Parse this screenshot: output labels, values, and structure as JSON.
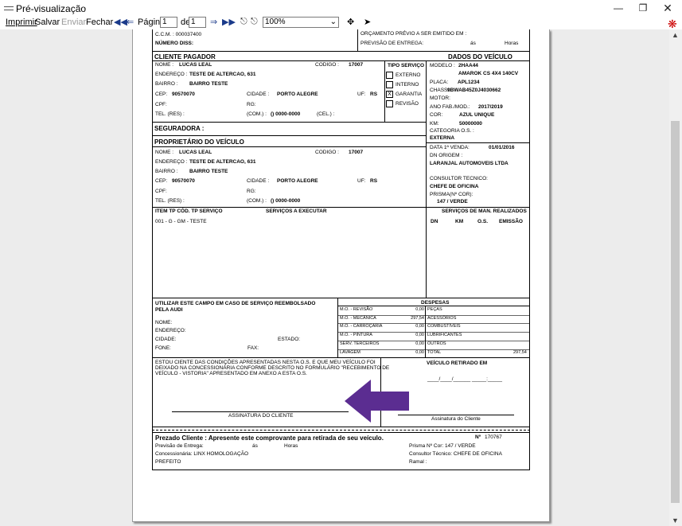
{
  "window": {
    "title": "Pré-visualização",
    "app_icon": "keyboard-icon"
  },
  "menu": {
    "imprimir": "Imprimir",
    "salvar": "Salvar",
    "enviar": "Enviar",
    "fechar": "Fechar",
    "pagina_label": "Página",
    "pagina_value": "1",
    "de_label": "de",
    "de_value": "1",
    "zoom": "100%"
  },
  "doc": {
    "ccm": "C.C.M. : 000037400",
    "numero_diss": "NÚMERO DISS:",
    "orcamento": "ORÇAMENTO PRÉVIO A SER EMITIDO EM :",
    "previsao": "PREVISÃO DE ENTREGA:",
    "as": "ás",
    "horas": "Horas",
    "cliente_pagador": "CLIENTE PAGADOR",
    "dados_veiculo": "DADOS DO VEÍCULO",
    "nome_label": "NOME :",
    "nome": "LUCAS LEAL",
    "codigo_label": "CODIGO :",
    "codigo": "17007",
    "endereco_label": "ENDEREÇO :",
    "endereco": "TESTE DE ALTERCAO, 631",
    "bairro_label": "BAIRRO :",
    "bairro": "BAIRRO TESTE",
    "cep_label": "CEP:",
    "cep": "90570070",
    "cidade_label": "CIDADE :",
    "cidade": "PORTO ALEGRE",
    "uf_label": "UF:",
    "uf": "RS",
    "cpf_label": "CPF:",
    "rg_label": "RG:",
    "tel_label": "TEL. (RES) :",
    "com_label": "(COM.) :",
    "com": "() 0000-0000",
    "cel_label": "(CEL.) :",
    "tipo_servico": "TIPO SERVIÇO",
    "tipo_opts": [
      "EXTERNO",
      "INTERNO",
      "GARANTIA",
      "REVISÃO"
    ],
    "tipo_checked": "X",
    "modelo_label": "MODELO :",
    "modelo": "2HAA44",
    "modelo2": "AMAROK CS 4X4 140CV",
    "placa_label": "PLACA:",
    "placa": "APL1234",
    "chassi_label": "CHASSI:",
    "chassi": "9BWAB45Z0J4030662",
    "motor_label": "MOTOR:",
    "anofab_label": "ANO FAB./MOD.:",
    "anofab": "2017/2019",
    "cor_label": "COR:",
    "cor": "AZUL UNIQUE",
    "km_label": "KM:",
    "km": "50000000",
    "categoria_label": "CATEGORIA O.S. :",
    "categoria": "EXTERNA",
    "data_venda_label": "DATA 1ª VENDA:",
    "data_venda": "01/01/2016",
    "dn_origem_label": "DN ORIGEM :",
    "dn_origem": "LARANJAL AUTOMOVEIS LTDA",
    "consultor_label": "CONSULTOR TECNICO:",
    "consultor": "CHEFE DE OFICINA",
    "prisma_label": "PRISMA(Nº COR):",
    "prisma": "147 / VERDE",
    "seguradora": "SEGURADORA :",
    "proprietario": "PROPRIETÁRIO DO VEÍCULO",
    "tel2": "() 0000-0000",
    "item_header": "ITEM  TP   CÓD. TP SERVIÇO",
    "servicos_executar": "SERVIÇOS A EXECUTAR",
    "servicos_man": "SERVIÇOS DE MAN. REALIZADOS",
    "dn_col": "DN",
    "km_col": "KM",
    "os_col": "O.S.",
    "emissao_col": "EMISSÃO",
    "item_line": "001 - G - GM - TESTE",
    "utilizar": "UTILIZAR ESTE CAMPO EM CASO DE SERVIÇO REEMBOLSADO",
    "pela_audi": "PELA AUDI",
    "nome_r": "NOME:",
    "endereco_r": "ENDEREÇO:",
    "cidade_r": "CIDADE:",
    "estado_r": "ESTADO:",
    "fone_r": "FONE:",
    "fax_r": "FAX:",
    "despesas": "DESPESAS",
    "desp_left": [
      "M.O. - REVISÃO",
      "M.O. - MECÂNICA",
      "M.O. - CARROÇARIA",
      "M.O. - PINTURA",
      "SERV. TERCEIROS",
      "LAVAGEM"
    ],
    "desp_left_v": [
      "0,00",
      "297,54",
      "0,00",
      "0,00",
      "0,00",
      "0,00"
    ],
    "desp_right": [
      "PEÇAS",
      "ACESSÓRIOS",
      "COMBUSTÍVEIS",
      "LUBRIFICANTES",
      "OUTROS",
      "TOTAL"
    ],
    "desp_total": "297,54",
    "estou1": "ESTOU CIENTE DAS CONDIÇÕES APRESENTADAS NESTA O.S. E QUE MEU VEÍCULO FOI",
    "estou2": "DEIXADO NA CONCESSIONÁRIA CONFORME DESCRITO NO FORMULÁRIO \"RECEBIMENTO DE",
    "estou3": "VEÍCULO - VISTORIA\" APRESENTADO EM ANEXO A ESTA O.S.",
    "veiculo_retirado": "VEÍCULO RETIRADO EM",
    "data_blank": "____/____/______    _____:_____",
    "assinatura_cliente": "ASSINATURA DO CLIENTE",
    "assinatura_cliente2": "Assinatura do Cliente",
    "prezado": "Prezado Cliente : Apresente este comprovante para retirada de seu veículo.",
    "num_label": "Nº",
    "num": "170767",
    "prev_entrega": "Previsão de Entrega:",
    "concessionaria": "Concessionária:  LINX HOMOLOGAÇÃO",
    "prefeito": "PREFEITO",
    "prisma_cor": "Prisma Nº Cor:  147   /  VERDE",
    "consultor_tec": "Consultor Técnico:   CHEFE DE OFICINA",
    "ramal": "Ramal :"
  }
}
